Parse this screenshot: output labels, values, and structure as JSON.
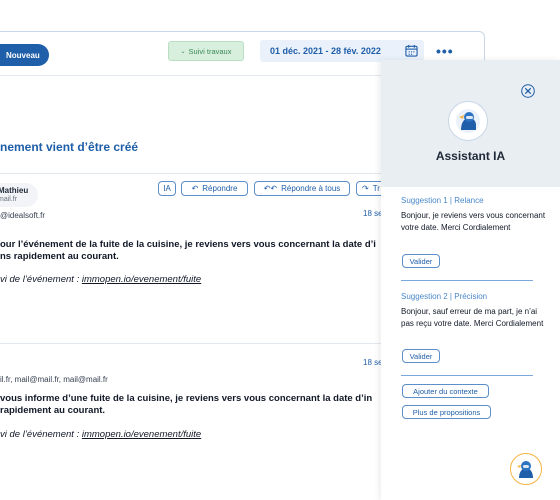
{
  "toolbar": {
    "new_label": "Nouveau",
    "status_label": "Suivi travaux",
    "date_range": "01 déc. 2021 - 28 fév. 2022",
    "more": "•••"
  },
  "page": {
    "title": "nement vient d’être créé"
  },
  "sender": {
    "name": "Mathieu",
    "email": "mail.fr"
  },
  "actions": {
    "ia": "IA",
    "reply": "Répondre",
    "reply_all": "Répondre à tous",
    "forward": "Tr"
  },
  "emails": [
    {
      "from": "@idealsoft.fr",
      "date": "18 se",
      "line1": "our l’événement de la fuite de la cuisine, je  reviens vers vous concernant la date d’i",
      "line2": "ns rapidement au courant.",
      "follow_label": "vi de l’événement : ",
      "follow_link": "immopen.io/evenement/fuite"
    },
    {
      "from": "il.fr, mail@mail.fr, mail@mail.fr",
      "date": "18 se",
      "line1": " vous informe d’une fuite de la cuisine, je  reviens vers vous concernant la date d’in",
      "line2": " rapidement au courant.",
      "follow_label": "vi de l’événement : ",
      "follow_link": "immopen.io/evenement/fuite"
    }
  ],
  "assistant": {
    "title": "Assistant IA",
    "suggestions": [
      {
        "label": "Suggestion 1 | Relance",
        "text": "Bonjour, je reviens vers vous concernant votre date. Merci Cordialement",
        "button": "Valider"
      },
      {
        "label": "Suggestion 2 | Précision",
        "text": "Bonjour, sauf erreur de ma part, je n’ai pas reçu votre date. Merci Cordialement",
        "button": "Valider"
      }
    ],
    "add_context": "Ajouter du contexte",
    "more_suggestions": "Plus de propositions"
  },
  "colors": {
    "accent": "#1f5ea8",
    "status_bg": "#d8efde",
    "panel_head": "#e9eef3",
    "fab_ring": "#f5b443"
  }
}
